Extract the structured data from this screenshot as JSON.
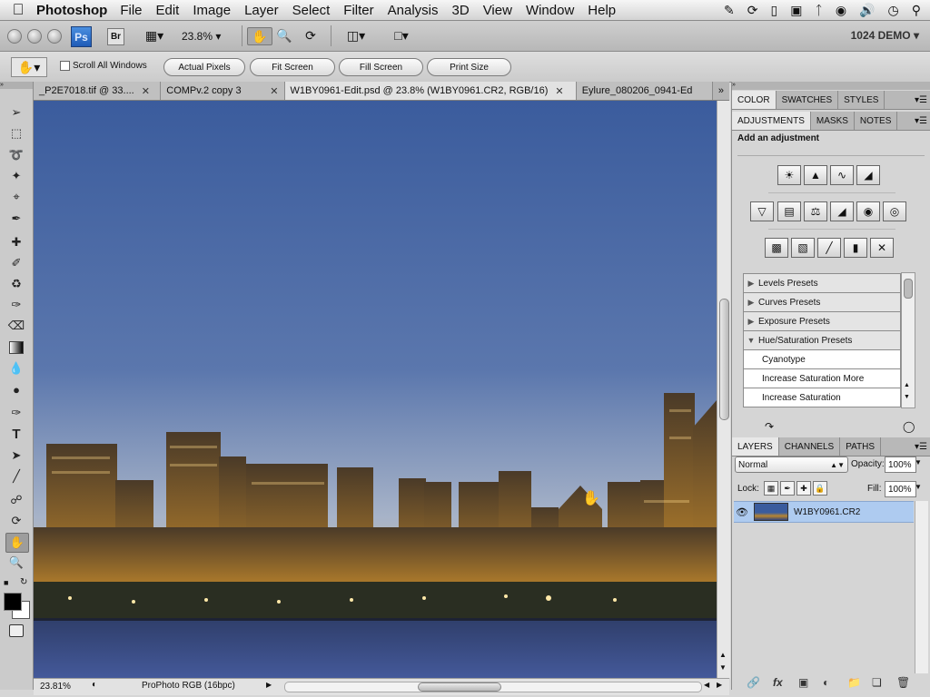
{
  "menubar": {
    "apple_icon": "apple-icon",
    "app_name": "Photoshop",
    "items": [
      "File",
      "Edit",
      "Image",
      "Layer",
      "Select",
      "Filter",
      "Analysis",
      "3D",
      "View",
      "Window",
      "Help"
    ]
  },
  "appbar": {
    "ps_label": "Ps",
    "br_label": "Br",
    "zoom_value": "23.8%",
    "workspace": "1024 DEMO"
  },
  "options": {
    "scroll_all_windows": "Scroll All Windows",
    "buttons": [
      "Actual Pixels",
      "Fit Screen",
      "Fill Screen",
      "Print Size"
    ]
  },
  "doc_tabs": [
    {
      "title": "_P2E7018.tif @ 33....",
      "active": false
    },
    {
      "title": "COMPv.2  copy 3",
      "active": false
    },
    {
      "title": "W1BY0961-Edit.psd @ 23.8% (W1BY0961.CR2, RGB/16)",
      "active": true
    },
    {
      "title": "Eylure_080206_0941-Ed",
      "active": false
    }
  ],
  "status": {
    "zoom": "23.81%",
    "profile": "ProPhoto RGB (16bpc)"
  },
  "panels": {
    "top_tabs": [
      "COLOR",
      "SWATCHES",
      "STYLES"
    ],
    "adj_tabs": [
      "ADJUSTMENTS",
      "MASKS",
      "NOTES"
    ],
    "adj_heading": "Add an adjustment",
    "presets": [
      {
        "label": "Levels Presets",
        "open": false
      },
      {
        "label": "Curves Presets",
        "open": false
      },
      {
        "label": "Exposure Presets",
        "open": false
      },
      {
        "label": "Hue/Saturation Presets",
        "open": true
      }
    ],
    "subpresets": [
      "Cyanotype",
      "Increase Saturation More",
      "Increase Saturation"
    ],
    "layer_tabs": [
      "LAYERS",
      "CHANNELS",
      "PATHS"
    ],
    "blend_mode": "Normal",
    "opacity_label": "Opacity:",
    "opacity_value": "100%",
    "lock_label": "Lock:",
    "fill_label": "Fill:",
    "fill_value": "100%",
    "layer_name": "W1BY0961.CR2"
  },
  "colors": {
    "sky_top": "#3c5d9e",
    "sky_bottom": "#8fa5c7",
    "city": "#c88a2c",
    "water": "#3a4f86",
    "selected_layer": "#aecbf0"
  }
}
